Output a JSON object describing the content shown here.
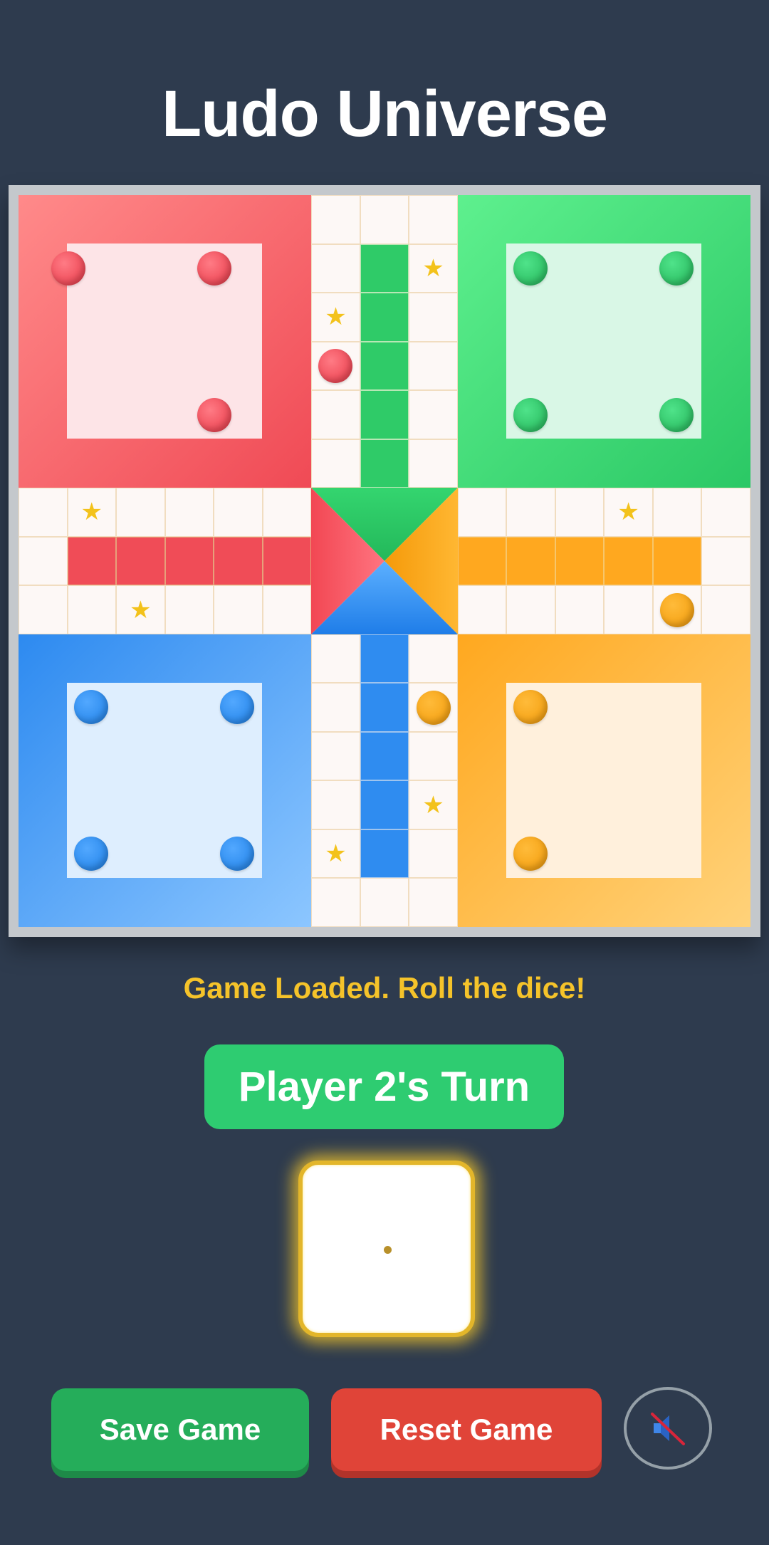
{
  "app": {
    "title": "Ludo Universe"
  },
  "colors": {
    "background": "#2e3b4e",
    "red": "#f04a55",
    "green": "#2ecc71",
    "blue": "#2d8af0",
    "yellow": "#ffa81f",
    "status_text": "#f5c32a"
  },
  "board": {
    "players": [
      "red",
      "green",
      "yellow",
      "blue"
    ],
    "star_icon": "star-icon",
    "home_tokens": {
      "red": [
        "top-left",
        "top-right",
        "bottom-right"
      ],
      "green": [
        "top-left",
        "top-right",
        "bottom-left",
        "bottom-right"
      ],
      "blue": [
        "top-left",
        "top-right",
        "bottom-left",
        "bottom-right"
      ],
      "yellow": [
        "top-left",
        "bottom-left"
      ]
    },
    "tokens_on_track": [
      {
        "color": "red",
        "cell": "top column left, row 4"
      },
      {
        "color": "yellow",
        "cell": "right arm bottom row, column 5"
      },
      {
        "color": "yellow",
        "cell": "bottom column right, row 2"
      }
    ]
  },
  "status": {
    "message": "Game Loaded. Roll the dice!"
  },
  "turn": {
    "label": "Player 2's Turn"
  },
  "dice": {
    "value": 1
  },
  "buttons": {
    "save": "Save Game",
    "reset": "Reset Game",
    "sound_icon": "speaker-muted-icon"
  }
}
